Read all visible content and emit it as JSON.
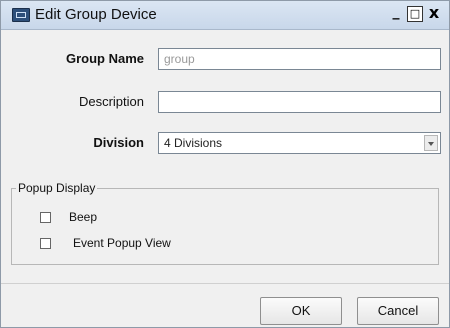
{
  "window": {
    "title": "Edit Group Device",
    "controls": {
      "minimize": "_",
      "maximize": "□",
      "close": "x"
    }
  },
  "form": {
    "group_name": {
      "label": "Group Name",
      "value": "group"
    },
    "description": {
      "label": "Description",
      "value": ""
    },
    "division": {
      "label": "Division",
      "selected": "4 Divisions"
    }
  },
  "popup_display": {
    "legend": "Popup Display",
    "options": [
      {
        "label": "Beep",
        "checked": false
      },
      {
        "label": "Event Popup View",
        "checked": false
      }
    ]
  },
  "buttons": {
    "ok": "OK",
    "cancel": "Cancel"
  },
  "icons": {
    "window_icon": "app-window-icon",
    "dropdown": "chevron-down-icon"
  }
}
